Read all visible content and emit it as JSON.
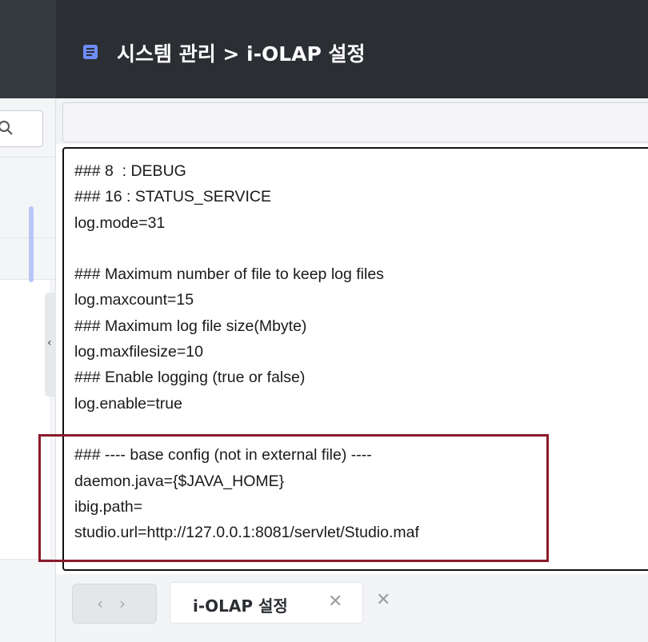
{
  "header": {
    "title": "시스템 관리 > i-OLAP 설정",
    "icon": "document-list-icon"
  },
  "sidebar": {
    "search_icon": "search-icon",
    "collapse_glyph": "‹"
  },
  "editor": {
    "lines": [
      "### 8  : DEBUG",
      "### 16 : STATUS_SERVICE",
      "log.mode=31",
      "",
      "### Maximum number of file to keep log files",
      "log.maxcount=15",
      "### Maximum log file size(Mbyte)",
      "log.maxfilesize=10",
      "### Enable logging (true or false)",
      "log.enable=true",
      "",
      "### ---- base config (not in external file) ----",
      "daemon.java={$JAVA_HOME}",
      "ibig.path=",
      "studio.url=http://127.0.0.1:8081/servlet/Studio.maf"
    ]
  },
  "tabs": {
    "prev": "‹",
    "next": "›",
    "active_label": "i-OLAP 설정",
    "close": "✕",
    "close_all": "✕"
  },
  "colors": {
    "header_bg": "#2b2e33",
    "highlight_border": "#8b1a2a",
    "accent_scroll": "#b9c7f7"
  }
}
